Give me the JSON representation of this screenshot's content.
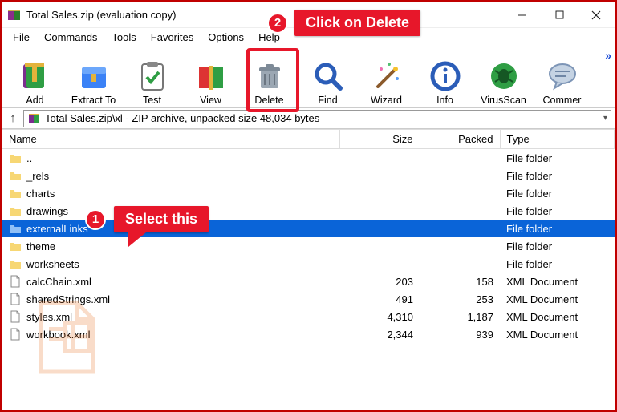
{
  "window": {
    "title": "Total Sales.zip (evaluation copy)"
  },
  "menubar": [
    "File",
    "Commands",
    "Tools",
    "Favorites",
    "Options",
    "Help"
  ],
  "toolbar": [
    {
      "key": "add",
      "label": "Add"
    },
    {
      "key": "extract",
      "label": "Extract To"
    },
    {
      "key": "test",
      "label": "Test"
    },
    {
      "key": "view",
      "label": "View"
    },
    {
      "key": "delete",
      "label": "Delete"
    },
    {
      "key": "find",
      "label": "Find"
    },
    {
      "key": "wizard",
      "label": "Wizard"
    },
    {
      "key": "info",
      "label": "Info"
    },
    {
      "key": "virus",
      "label": "VirusScan"
    },
    {
      "key": "comment",
      "label": "Commer"
    }
  ],
  "addressbar": {
    "text": "Total Sales.zip\\xl - ZIP archive, unpacked size 48,034 bytes"
  },
  "columns": {
    "name": "Name",
    "size": "Size",
    "packed": "Packed",
    "type": "Type"
  },
  "files": [
    {
      "name": "..",
      "size": "",
      "packed": "",
      "type": "File folder",
      "icon": "folder"
    },
    {
      "name": "_rels",
      "size": "",
      "packed": "",
      "type": "File folder",
      "icon": "folder"
    },
    {
      "name": "charts",
      "size": "",
      "packed": "",
      "type": "File folder",
      "icon": "folder"
    },
    {
      "name": "drawings",
      "size": "",
      "packed": "",
      "type": "File folder",
      "icon": "folder"
    },
    {
      "name": "externalLinks",
      "size": "",
      "packed": "",
      "type": "File folder",
      "icon": "folder",
      "selected": true
    },
    {
      "name": "theme",
      "size": "",
      "packed": "",
      "type": "File folder",
      "icon": "folder"
    },
    {
      "name": "worksheets",
      "size": "",
      "packed": "",
      "type": "File folder",
      "icon": "folder"
    },
    {
      "name": "calcChain.xml",
      "size": "203",
      "packed": "158",
      "type": "XML Document",
      "icon": "xml"
    },
    {
      "name": "sharedStrings.xml",
      "size": "491",
      "packed": "253",
      "type": "XML Document",
      "icon": "xml"
    },
    {
      "name": "styles.xml",
      "size": "4,310",
      "packed": "1,187",
      "type": "XML Document",
      "icon": "xml"
    },
    {
      "name": "workbook.xml",
      "size": "2,344",
      "packed": "939",
      "type": "XML Document",
      "icon": "xml"
    }
  ],
  "annotations": {
    "step1": {
      "num": "1",
      "text": "Select this"
    },
    "step2": {
      "num": "2",
      "text": "Click on Delete"
    }
  }
}
